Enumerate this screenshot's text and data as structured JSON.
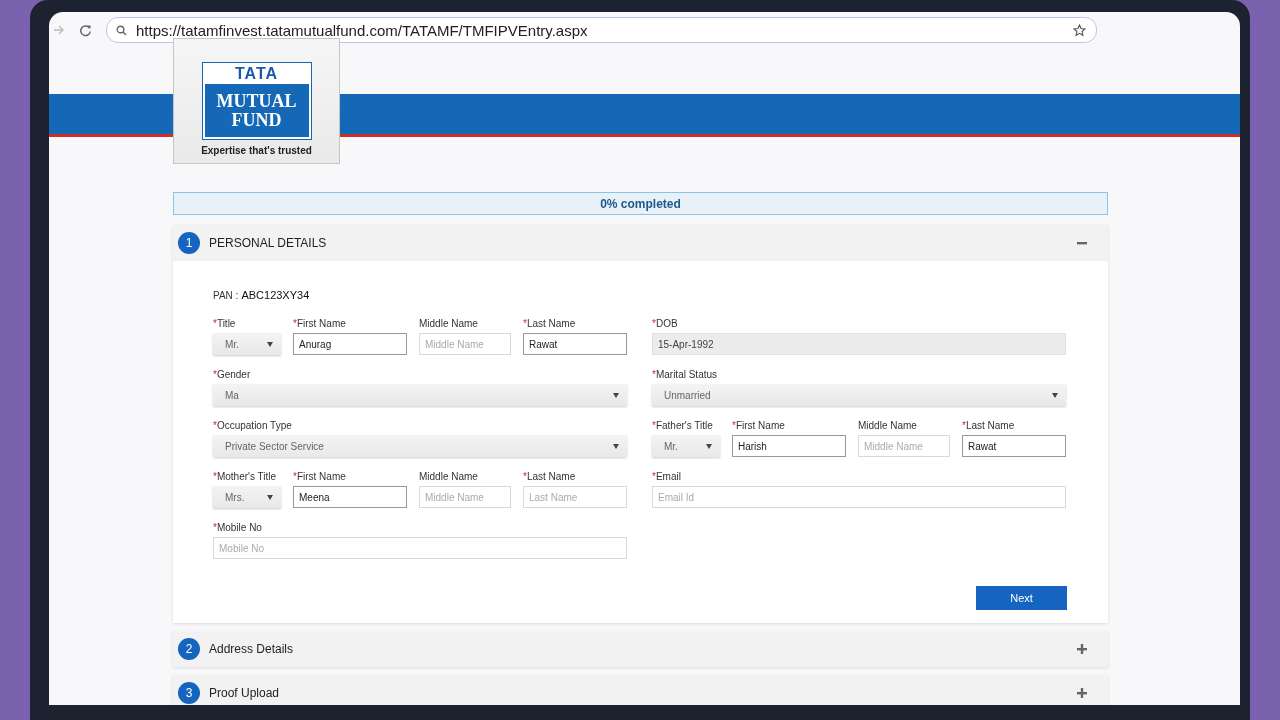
{
  "browser": {
    "url": "https://tatamfinvest.tatamutualfund.com/TATAMF/TMFIPVEntry.aspx"
  },
  "logo": {
    "line_1": "TATA",
    "line_2": "MUTUAL",
    "line_3": "FUND",
    "tagline": "Expertise that's trusted"
  },
  "progress": {
    "label": "0% completed",
    "level": 0
  },
  "sections": [
    {
      "number": "1",
      "title": "PERSONAL DETAILS",
      "expanded": true,
      "pan": {
        "label": "PAN :",
        "value": "ABC123XY34"
      },
      "rows": [
        [
          {
            "fields": [
              {
                "kind": "select",
                "mark": "*",
                "label": "Title",
                "value": "Mr."
              },
              {
                "kind": "text",
                "mark": "*",
                "label": "First Name",
                "value": "Anurag"
              },
              {
                "kind": "text",
                "label": "Middle Name",
                "placeholder": "Middle Name"
              },
              {
                "kind": "text",
                "mark": "*",
                "label": "Last Name",
                "value": "Rawat"
              }
            ]
          },
          {
            "fields": [
              {
                "kind": "date",
                "mark": "*",
                "label": "DOB",
                "value": "15-Apr-1992"
              }
            ]
          }
        ],
        [
          {
            "fields": [
              {
                "kind": "select",
                "mark": "*",
                "label": "Gender",
                "value": "Ma"
              }
            ]
          },
          {
            "fields": [
              {
                "kind": "select",
                "mark": "*",
                "label": "Marital Status",
                "value": "Unmarried"
              }
            ]
          }
        ],
        [
          {
            "fields": [
              {
                "kind": "select",
                "mark": "*",
                "label": "Occupation Type",
                "value": "Private Sector Service"
              }
            ]
          },
          {
            "fields": [
              {
                "kind": "select",
                "mark": "*",
                "label": "Father's Title",
                "value": "Mr."
              },
              {
                "kind": "text",
                "mark": "*",
                "label": "First Name",
                "value": "Harish"
              },
              {
                "kind": "text",
                "label": "Middle Name",
                "placeholder": "Middle Name"
              },
              {
                "kind": "text",
                "mark": "*",
                "label": "Last Name",
                "value": "Rawat"
              }
            ]
          }
        ],
        [
          {
            "fields": [
              {
                "kind": "select",
                "mark": "*",
                "label": "Mother's Title",
                "value": "Mrs."
              },
              {
                "kind": "text",
                "mark": "*",
                "label": "First Name",
                "value": "Meena"
              },
              {
                "kind": "text",
                "label": "Middle Name",
                "placeholder": "Middle Name"
              },
              {
                "kind": "text",
                "mark": "*",
                "label": "Last Name",
                "placeholder": "Last Name"
              }
            ]
          },
          {
            "fields": [
              {
                "kind": "text",
                "mark": "*",
                "label": "Email",
                "placeholder": "Email Id"
              }
            ]
          }
        ],
        [
          {
            "fields": [
              {
                "kind": "text",
                "mark": "*",
                "label": "Mobile No",
                "placeholder": "Mobile No"
              }
            ]
          }
        ]
      ],
      "button": "Next"
    },
    {
      "number": "2",
      "title": "Address Details",
      "expanded": false
    },
    {
      "number": "3",
      "title": "Proof Upload",
      "expanded": false
    }
  ]
}
